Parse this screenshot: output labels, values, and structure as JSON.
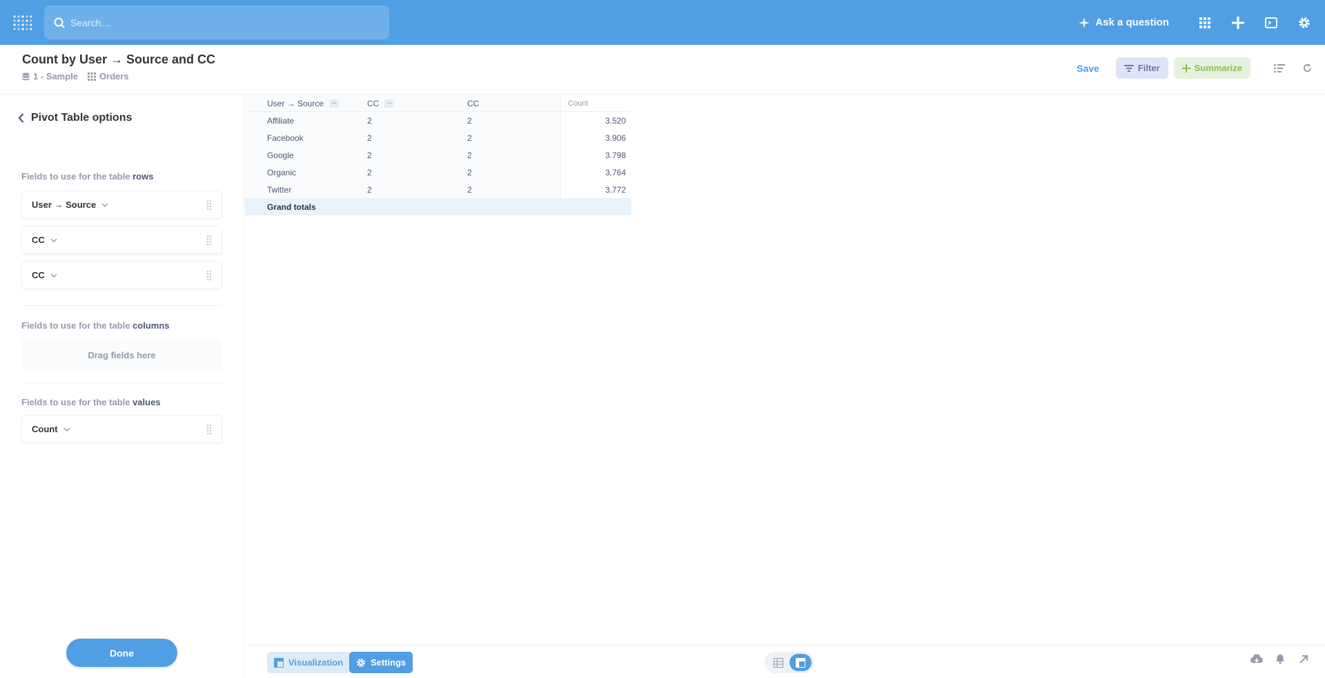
{
  "colors": {
    "brand": "#509ee3",
    "filter": "#7172ad",
    "summarize": "#88bf4d",
    "text": "#4c5773"
  },
  "nav": {
    "search_placeholder": "Search…",
    "ask_label": "Ask a question",
    "icons": [
      "apps-grid-icon",
      "plus-icon",
      "sql-editor-icon",
      "gear-icon"
    ]
  },
  "header": {
    "title": "Count by User → Source and CC",
    "database": "1 - Sample",
    "table": "Orders",
    "save_label": "Save",
    "filter_label": "Filter",
    "summarize_label": "Summarize"
  },
  "sidebar": {
    "back_label": "Pivot Table options",
    "rows_section": {
      "prefix": "Fields to use for the table ",
      "bold": "rows"
    },
    "rows_fields": [
      "User → Source",
      "CC",
      "CC"
    ],
    "columns_section": {
      "prefix": "Fields to use for the table ",
      "bold": "columns"
    },
    "columns_placeholder": "Drag fields here",
    "values_section": {
      "prefix": "Fields to use for the table ",
      "bold": "values"
    },
    "values_fields": [
      "Count"
    ],
    "done_label": "Done"
  },
  "table": {
    "headers": [
      "User → Source",
      "CC",
      "CC",
      "Count"
    ],
    "rows": [
      [
        "Affiliate",
        "2",
        "2",
        "3.520"
      ],
      [
        "Facebook",
        "2",
        "2",
        "3.906"
      ],
      [
        "Google",
        "2",
        "2",
        "3.798"
      ],
      [
        "Organic",
        "2",
        "2",
        "3.764"
      ],
      [
        "Twitter",
        "2",
        "2",
        "3.772"
      ]
    ],
    "grand_total_label": "Grand totals"
  },
  "footer": {
    "visualization_label": "Visualization",
    "settings_label": "Settings"
  }
}
